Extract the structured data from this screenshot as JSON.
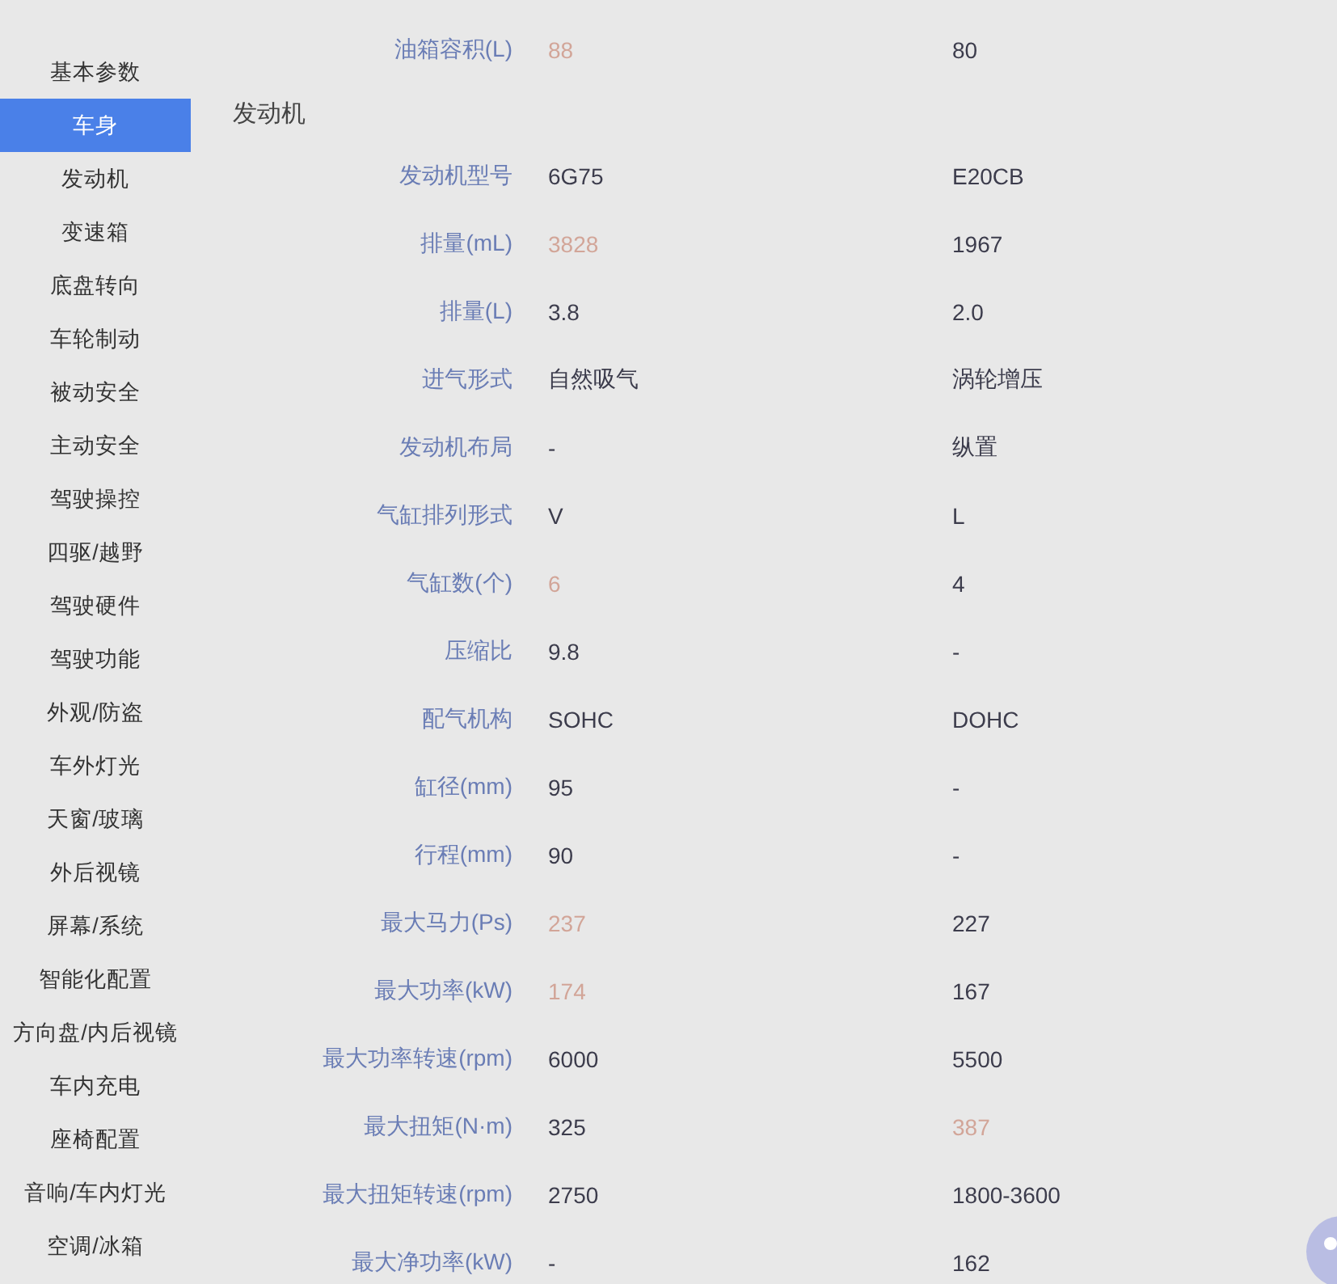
{
  "sidebar": {
    "items": [
      {
        "label": "基本参数",
        "selected": false
      },
      {
        "label": "车身",
        "selected": true
      },
      {
        "label": "发动机",
        "selected": false
      },
      {
        "label": "变速箱",
        "selected": false
      },
      {
        "label": "底盘转向",
        "selected": false
      },
      {
        "label": "车轮制动",
        "selected": false
      },
      {
        "label": "被动安全",
        "selected": false
      },
      {
        "label": "主动安全",
        "selected": false
      },
      {
        "label": "驾驶操控",
        "selected": false
      },
      {
        "label": "四驱/越野",
        "selected": false
      },
      {
        "label": "驾驶硬件",
        "selected": false
      },
      {
        "label": "驾驶功能",
        "selected": false
      },
      {
        "label": "外观/防盗",
        "selected": false
      },
      {
        "label": "车外灯光",
        "selected": false
      },
      {
        "label": "天窗/玻璃",
        "selected": false
      },
      {
        "label": "外后视镜",
        "selected": false
      },
      {
        "label": "屏幕/系统",
        "selected": false
      },
      {
        "label": "智能化配置",
        "selected": false
      },
      {
        "label": "方向盘/内后视镜",
        "selected": false
      },
      {
        "label": "车内充电",
        "selected": false
      },
      {
        "label": "座椅配置",
        "selected": false
      },
      {
        "label": "音响/车内灯光",
        "selected": false
      },
      {
        "label": "空调/冰箱",
        "selected": false
      }
    ]
  },
  "spec_table": {
    "rows": [
      {
        "kind": "row",
        "label": "油箱容积(L)",
        "values": [
          {
            "text": "88",
            "highlighted": true
          },
          {
            "text": "80",
            "highlighted": false
          }
        ]
      },
      {
        "kind": "section",
        "label": "发动机"
      },
      {
        "kind": "row",
        "label": "发动机型号",
        "values": [
          {
            "text": "6G75",
            "highlighted": false
          },
          {
            "text": "E20CB",
            "highlighted": false
          }
        ]
      },
      {
        "kind": "row",
        "label": "排量(mL)",
        "values": [
          {
            "text": "3828",
            "highlighted": true
          },
          {
            "text": "1967",
            "highlighted": false
          }
        ]
      },
      {
        "kind": "row",
        "label": "排量(L)",
        "values": [
          {
            "text": "3.8",
            "highlighted": false
          },
          {
            "text": "2.0",
            "highlighted": false
          }
        ]
      },
      {
        "kind": "row",
        "label": "进气形式",
        "values": [
          {
            "text": "自然吸气",
            "highlighted": false
          },
          {
            "text": "涡轮增压",
            "highlighted": false
          }
        ]
      },
      {
        "kind": "row",
        "label": "发动机布局",
        "values": [
          {
            "text": "-",
            "highlighted": false
          },
          {
            "text": "纵置",
            "highlighted": false
          }
        ]
      },
      {
        "kind": "row",
        "label": "气缸排列形式",
        "values": [
          {
            "text": "V",
            "highlighted": false
          },
          {
            "text": "L",
            "highlighted": false
          }
        ]
      },
      {
        "kind": "row",
        "label": "气缸数(个)",
        "values": [
          {
            "text": "6",
            "highlighted": true
          },
          {
            "text": "4",
            "highlighted": false
          }
        ]
      },
      {
        "kind": "row",
        "label": "压缩比",
        "values": [
          {
            "text": "9.8",
            "highlighted": false
          },
          {
            "text": "-",
            "highlighted": false
          }
        ]
      },
      {
        "kind": "row",
        "label": "配气机构",
        "values": [
          {
            "text": "SOHC",
            "highlighted": false
          },
          {
            "text": "DOHC",
            "highlighted": false
          }
        ]
      },
      {
        "kind": "row",
        "label": "缸径(mm)",
        "values": [
          {
            "text": "95",
            "highlighted": false
          },
          {
            "text": "-",
            "highlighted": false
          }
        ]
      },
      {
        "kind": "row",
        "label": "行程(mm)",
        "values": [
          {
            "text": "90",
            "highlighted": false
          },
          {
            "text": "-",
            "highlighted": false
          }
        ]
      },
      {
        "kind": "row",
        "label": "最大马力(Ps)",
        "values": [
          {
            "text": "237",
            "highlighted": true
          },
          {
            "text": "227",
            "highlighted": false
          }
        ]
      },
      {
        "kind": "row",
        "label": "最大功率(kW)",
        "values": [
          {
            "text": "174",
            "highlighted": true
          },
          {
            "text": "167",
            "highlighted": false
          }
        ]
      },
      {
        "kind": "row",
        "label": "最大功率转速(rpm)",
        "values": [
          {
            "text": "6000",
            "highlighted": false
          },
          {
            "text": "5500",
            "highlighted": false
          }
        ]
      },
      {
        "kind": "row",
        "label": "最大扭矩(N·m)",
        "values": [
          {
            "text": "325",
            "highlighted": false
          },
          {
            "text": "387",
            "highlighted": true
          }
        ]
      },
      {
        "kind": "row",
        "label": "最大扭矩转速(rpm)",
        "values": [
          {
            "text": "2750",
            "highlighted": false
          },
          {
            "text": "1800-3600",
            "highlighted": false
          }
        ]
      },
      {
        "kind": "row",
        "label": "最大净功率(kW)",
        "values": [
          {
            "text": "-",
            "highlighted": false
          },
          {
            "text": "162",
            "highlighted": false
          }
        ]
      }
    ]
  }
}
